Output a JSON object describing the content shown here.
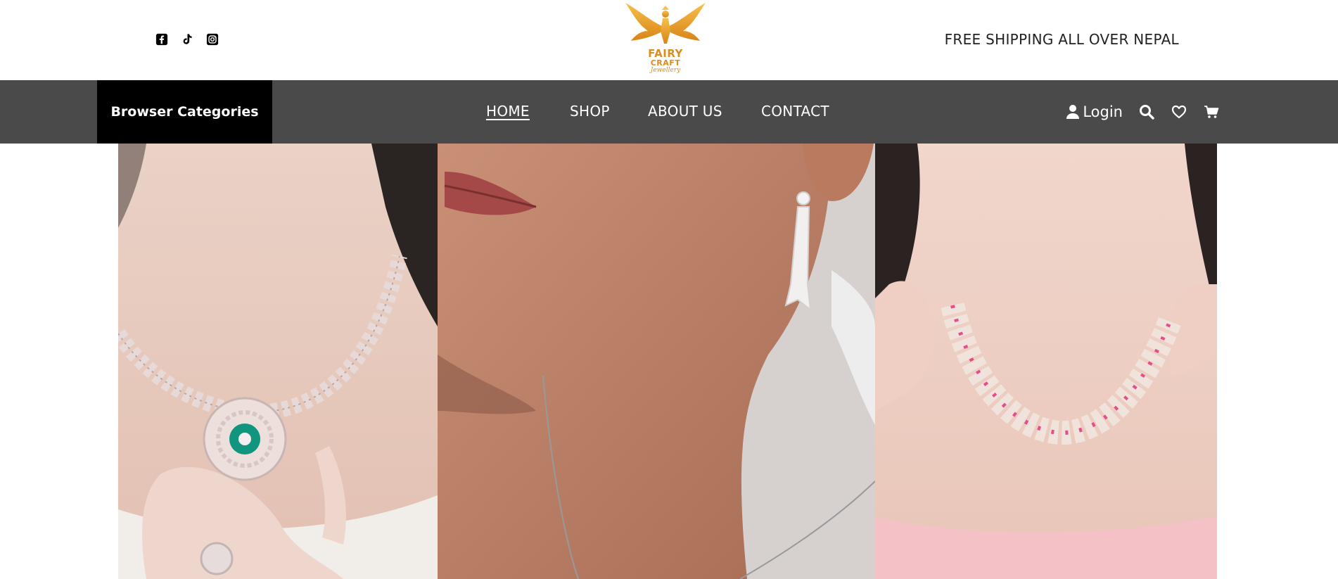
{
  "header": {
    "social_icons": [
      "facebook-icon",
      "tiktok-icon",
      "instagram-icon"
    ],
    "logo": {
      "line1": "FAIRY",
      "line2": "CRAFT",
      "line3": "Jewellery"
    },
    "shipping_text": "FREE SHIPPING ALL OVER NEPAL"
  },
  "nav": {
    "categories_label": "Browser Categories",
    "links": [
      {
        "label": "HOME",
        "active": true
      },
      {
        "label": "SHOP",
        "active": false
      },
      {
        "label": "ABOUT US",
        "active": false
      },
      {
        "label": "CONTACT",
        "active": false
      }
    ],
    "login_label": "Login",
    "icons": [
      "user-icon",
      "search-icon",
      "heart-icon",
      "cart-icon"
    ]
  },
  "hero": {
    "panels": [
      {
        "subject": "necklace-with-green-pendant"
      },
      {
        "subject": "drop-earring"
      },
      {
        "subject": "pink-stone-necklace"
      }
    ]
  },
  "colors": {
    "navbar_bg": "#4a4a4a",
    "category_bg": "#000000",
    "logo_gold": "#d98e1f",
    "text_dark": "#222222"
  }
}
